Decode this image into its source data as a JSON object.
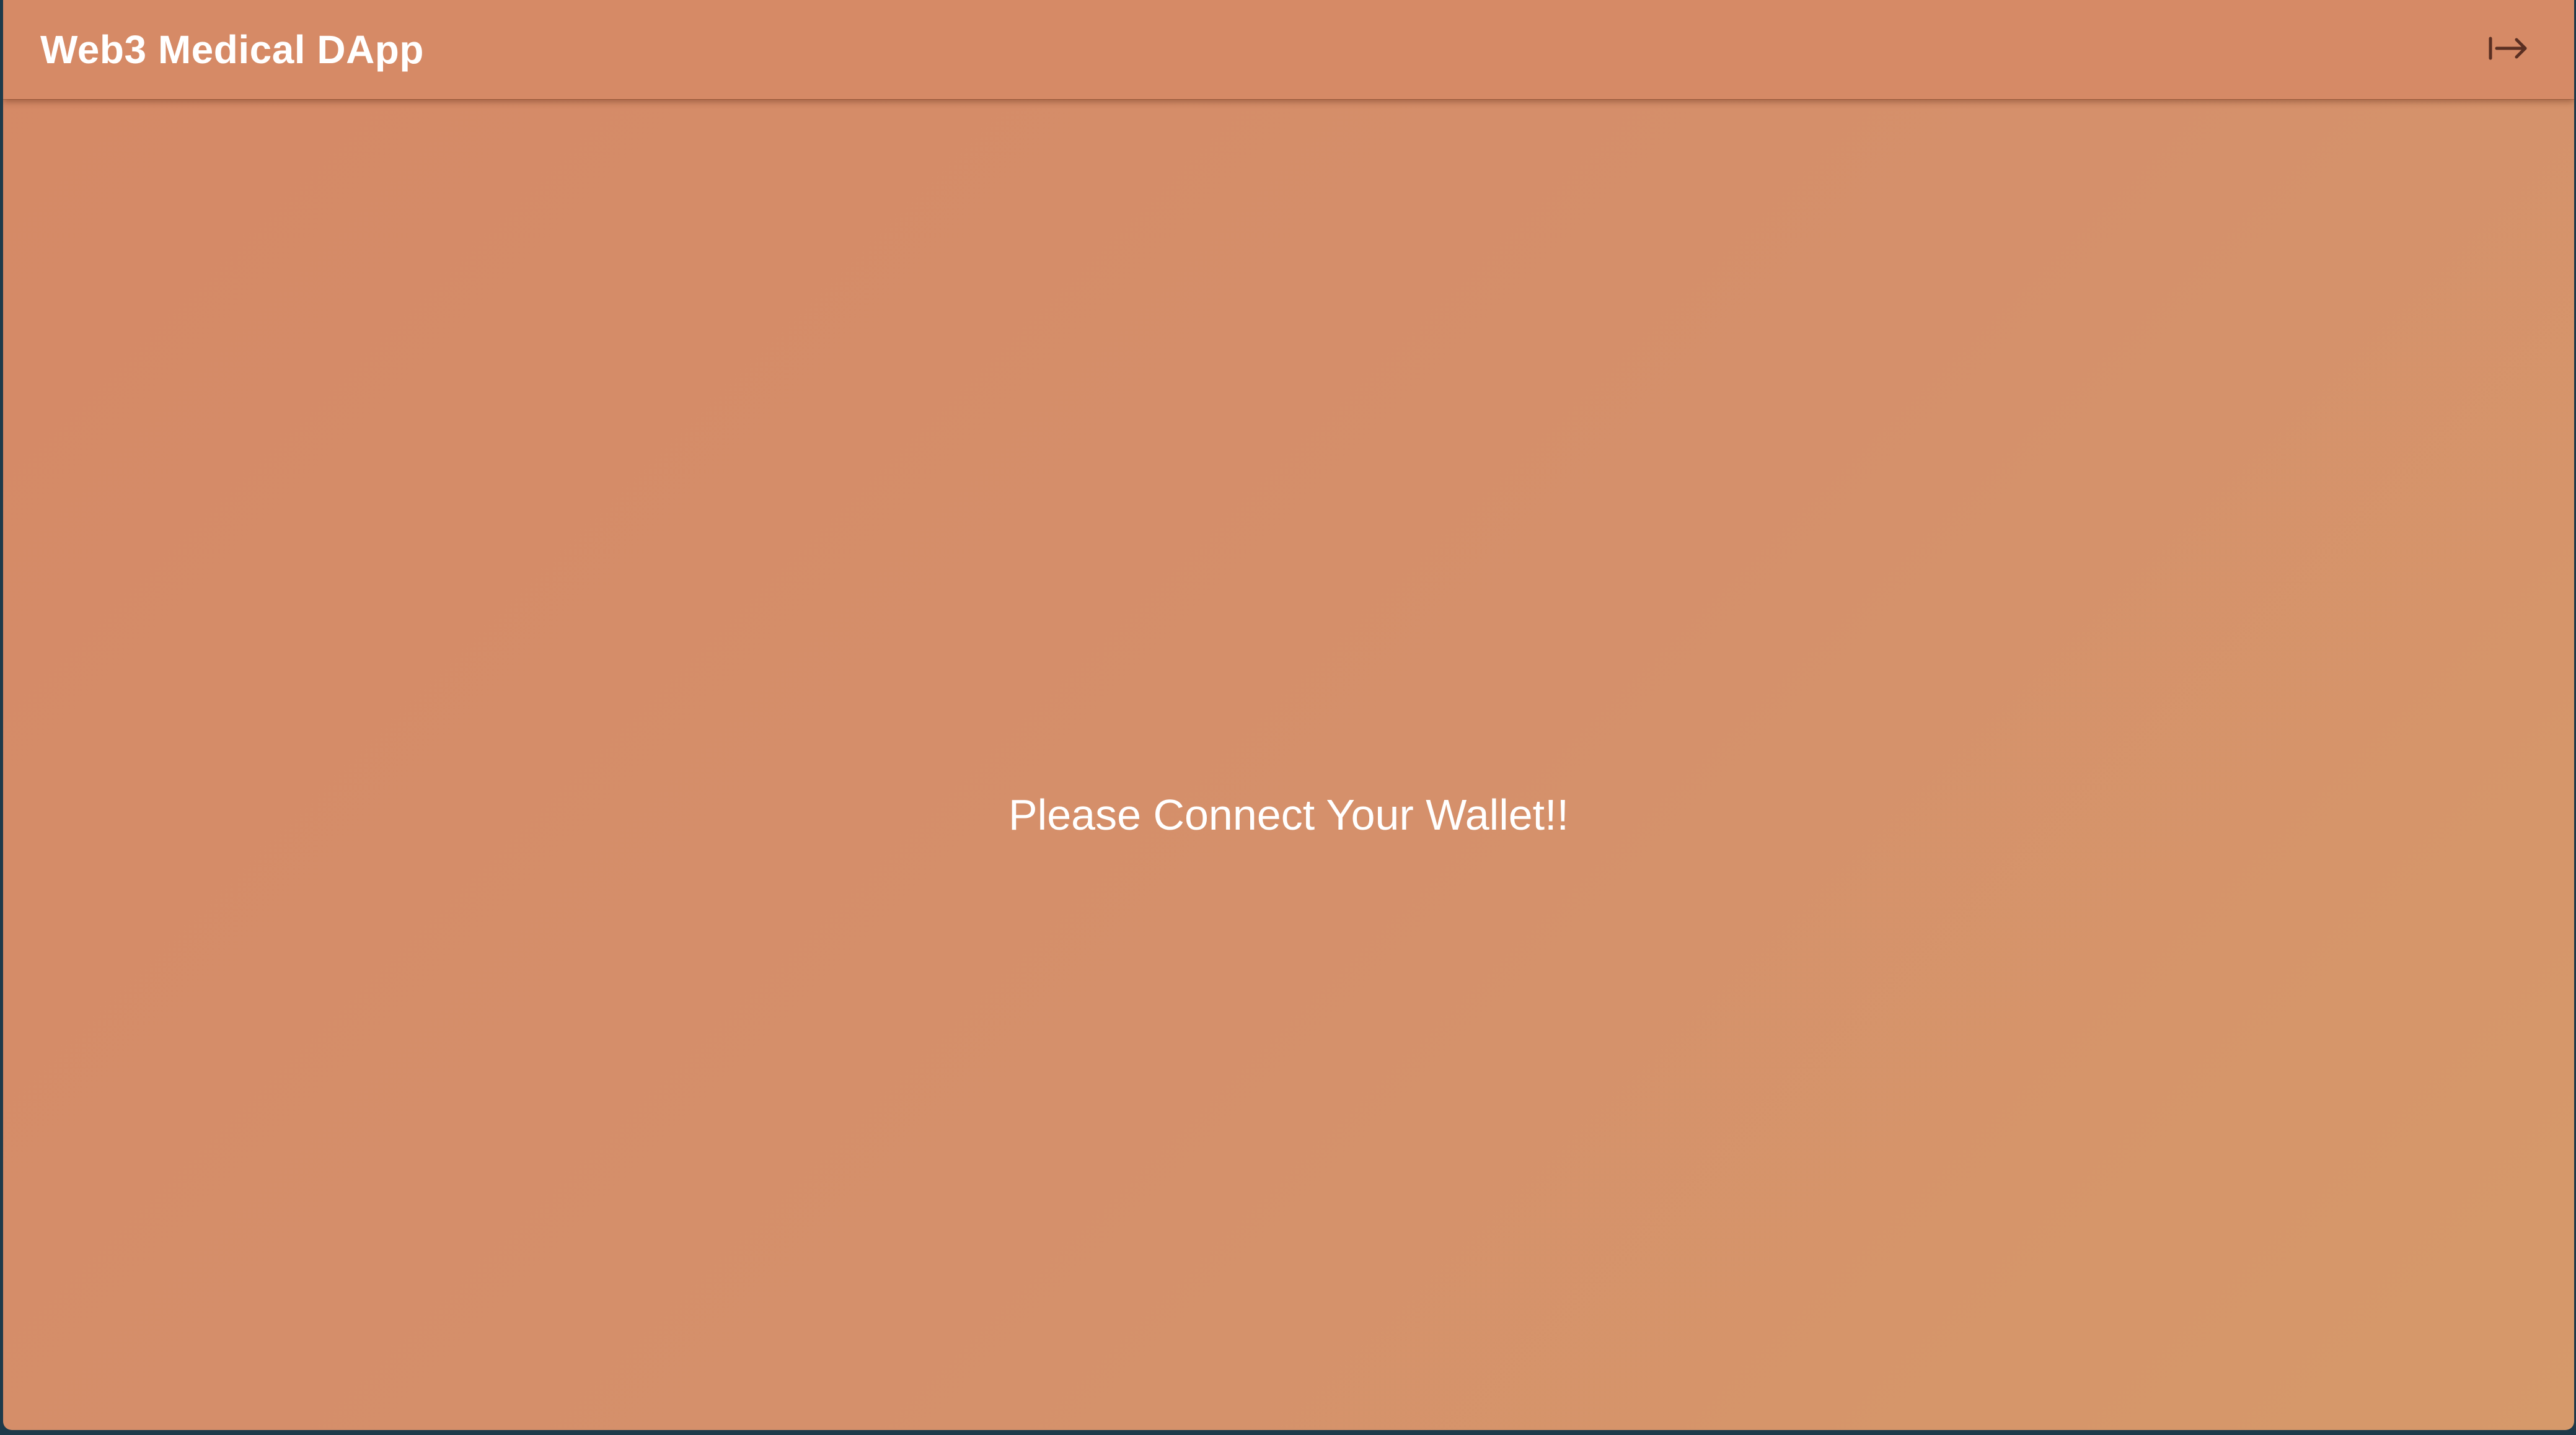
{
  "app_bar": {
    "title": "Web3 Medical DApp",
    "action_icon": "logout-icon"
  },
  "main": {
    "message": "Please Connect Your Wallet!!"
  },
  "colors": {
    "background": "#d68a66",
    "text": "#ffffff",
    "icon": "#5a2f22"
  }
}
